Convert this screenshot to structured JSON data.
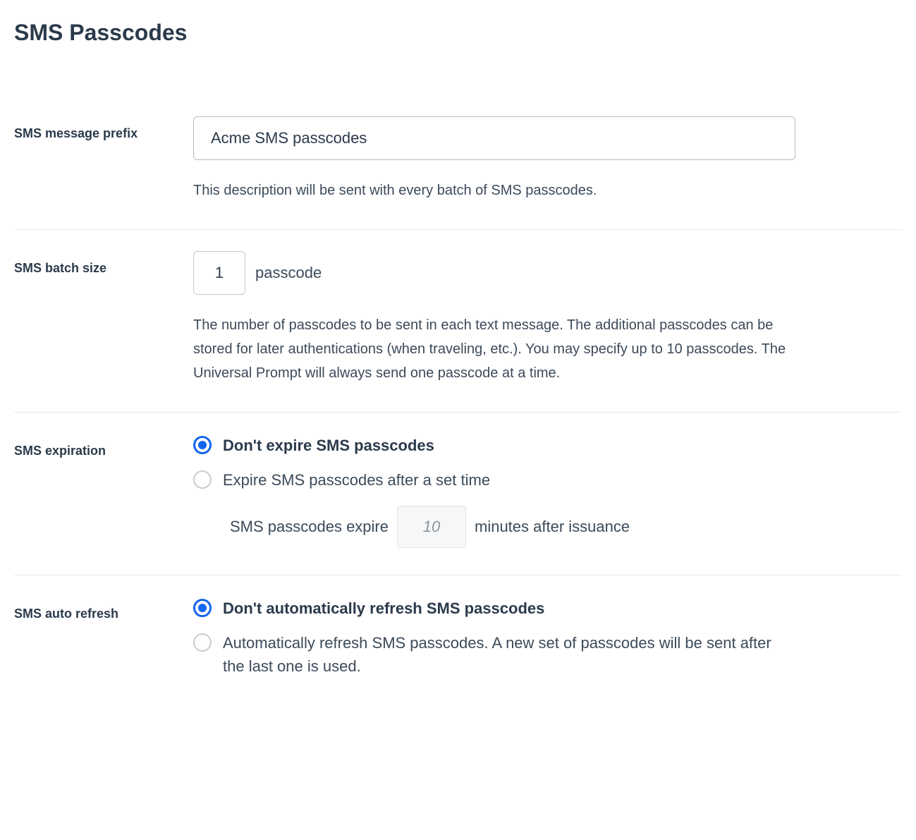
{
  "title": "SMS Passcodes",
  "prefix": {
    "label": "SMS message prefix",
    "value": "Acme SMS passcodes",
    "help": "This description will be sent with every batch of SMS passcodes."
  },
  "batch": {
    "label": "SMS batch size",
    "value": "1",
    "unit": "passcode",
    "help": "The number of passcodes to be sent in each text message. The additional passcodes can be stored for later authentications (when traveling, etc.). You may specify up to 10 passcodes. The Universal Prompt will always send one passcode at a time."
  },
  "expiration": {
    "label": "SMS expiration",
    "options": [
      {
        "label": "Don't expire SMS passcodes",
        "selected": true
      },
      {
        "label": "Expire SMS passcodes after a set time",
        "selected": false
      }
    ],
    "sub": {
      "prefix": "SMS passcodes expire",
      "value": "10",
      "suffix": "minutes after issuance"
    }
  },
  "autorefresh": {
    "label": "SMS auto refresh",
    "options": [
      {
        "label": "Don't automatically refresh SMS passcodes",
        "selected": true
      },
      {
        "label": "Automatically refresh SMS passcodes. A new set of passcodes will be sent after the last one is used.",
        "selected": false
      }
    ]
  }
}
